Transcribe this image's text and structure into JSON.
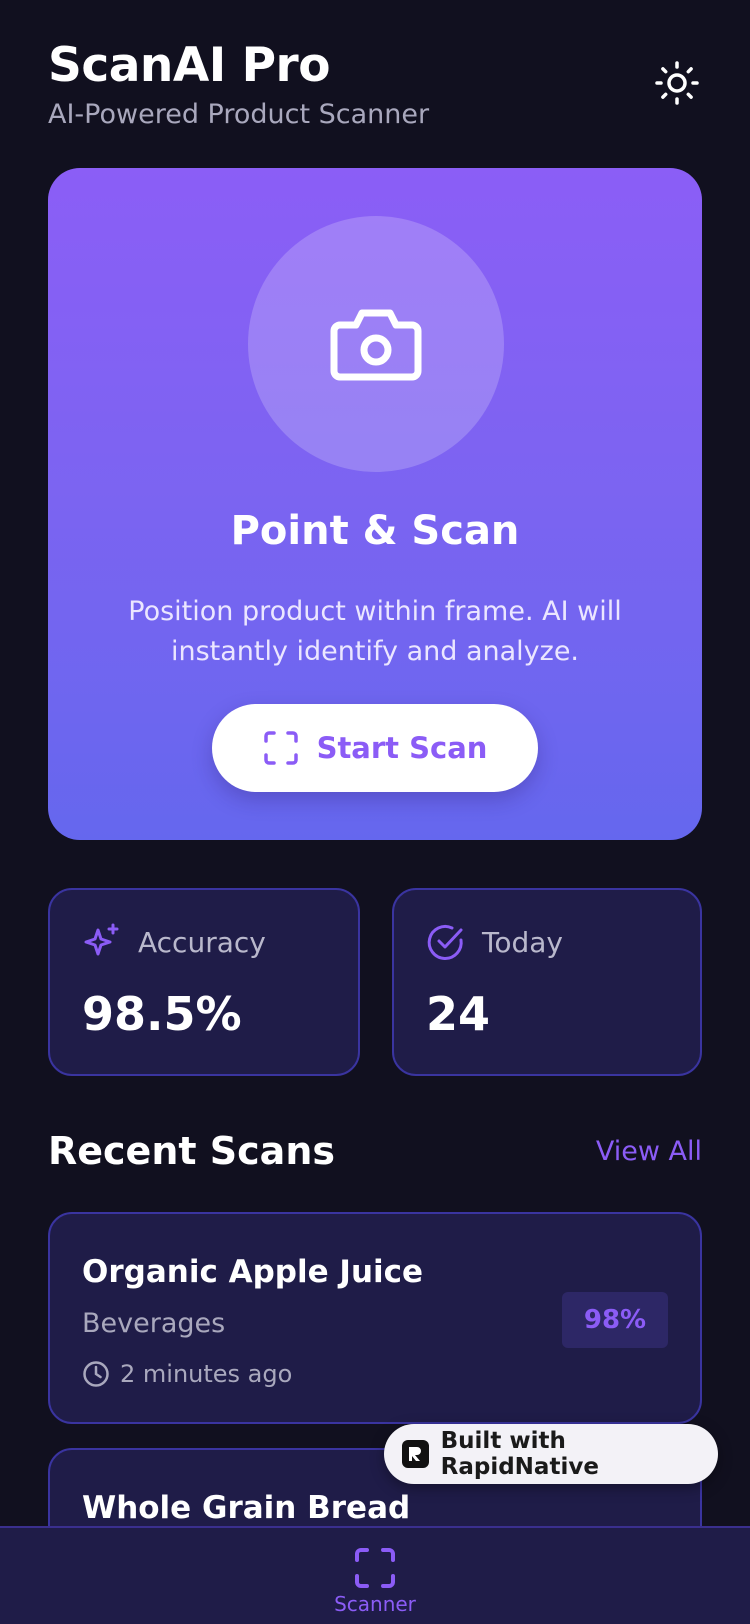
{
  "app": {
    "title": "ScanAI Pro",
    "subtitle": "AI-Powered Product Scanner"
  },
  "hero": {
    "title": "Point & Scan",
    "description": "Position product within frame. AI will instantly identify and analyze.",
    "button_label": "Start Scan"
  },
  "stats": [
    {
      "label": "Accuracy",
      "value": "98.5%",
      "icon": "sparkles-icon"
    },
    {
      "label": "Today",
      "value": "24",
      "icon": "check-circle-icon"
    }
  ],
  "recent": {
    "title": "Recent Scans",
    "view_all": "View All",
    "items": [
      {
        "name": "Organic Apple Juice",
        "category": "Beverages",
        "time": "2 minutes ago",
        "score": "98%"
      },
      {
        "name": "Whole Grain Bread"
      }
    ]
  },
  "badge": {
    "label": "Built with RapidNative"
  },
  "nav": {
    "items": [
      {
        "label": "Scanner",
        "icon": "scan-frame-icon"
      }
    ]
  },
  "colors": {
    "background": "#11101f",
    "accent": "#8b5cf6",
    "card": "#1f1c48",
    "card_border": "#3a34a0",
    "hero_gradient_top": "#8b5ef6",
    "hero_gradient_bottom": "#6567ee"
  }
}
